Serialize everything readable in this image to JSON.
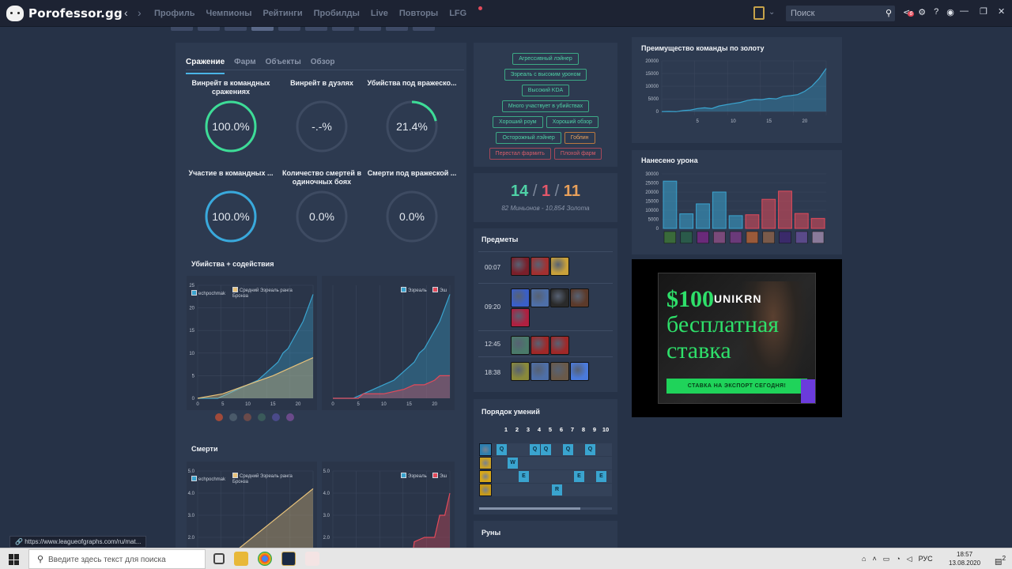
{
  "app": {
    "logo_text": "Porofessor.gg"
  },
  "nav": {
    "back": "‹",
    "forward": "›",
    "items": [
      "Профиль",
      "Чемпионы",
      "Рейтинги",
      "Пробилды",
      "Live",
      "Повторы",
      "LFG"
    ]
  },
  "search": {
    "placeholder": "Поиск"
  },
  "tabs": [
    "Сражение",
    "Фарм",
    "Объекты",
    "Обзор"
  ],
  "stats": [
    {
      "label": "Винрейт в командных сражениях",
      "value": "100.0%",
      "progress": 1.0,
      "color": "#3ddc97"
    },
    {
      "label": "Винрейт в дуэлях",
      "value": "-.-%",
      "progress": 0,
      "color": "#3ddc97"
    },
    {
      "label": "Убийства под вражеско...",
      "value": "21.4%",
      "progress": 0.214,
      "color": "#3ddc97"
    },
    {
      "label": "Участие в командных ...",
      "value": "100.0%",
      "progress": 1.0,
      "color": "#39a9dc"
    },
    {
      "label": "Количество смертей в одиночных боях",
      "value": "0.0%",
      "progress": 0,
      "color": "#39a9dc"
    },
    {
      "label": "Смерти под вражеской ...",
      "value": "0.0%",
      "progress": 0,
      "color": "#39a9dc"
    }
  ],
  "kills_section": {
    "title": "Убийства + содействия"
  },
  "deaths_section": {
    "title": "Смерти"
  },
  "chart_data": [
    {
      "type": "area",
      "title": "Убийства + содействия",
      "ylim": [
        0,
        25
      ],
      "yticks": [
        0,
        5,
        10,
        15,
        20,
        25
      ],
      "xticks": [
        0,
        5,
        10,
        15,
        20
      ],
      "series": [
        {
          "name": "echpochmak",
          "color": "#3aa4cf",
          "x": [
            0,
            4,
            6,
            8,
            10,
            12,
            14,
            15,
            16,
            17,
            18,
            19,
            20,
            21,
            22,
            23
          ],
          "values": [
            0,
            0,
            1,
            2,
            3,
            4,
            6,
            7,
            8,
            10,
            11,
            13,
            15,
            17,
            20,
            23
          ]
        },
        {
          "name": "Средний Эзреаль ранга Бронза",
          "color": "#e8c27a",
          "x": [
            0,
            5,
            10,
            15,
            20,
            23
          ],
          "values": [
            0,
            1,
            3,
            5,
            7.5,
            9
          ]
        }
      ]
    },
    {
      "type": "area",
      "title": "",
      "ylim": [
        0,
        25
      ],
      "xticks": [
        0,
        5,
        10,
        15,
        20
      ],
      "series": [
        {
          "name": "Эзреаль",
          "color": "#3aa4cf",
          "x": [
            0,
            4,
            6,
            8,
            10,
            12,
            14,
            15,
            16,
            17,
            18,
            19,
            20,
            21,
            22,
            23
          ],
          "values": [
            0,
            0,
            1,
            2,
            3,
            4,
            6,
            7,
            8,
            10,
            11,
            13,
            15,
            17,
            20,
            23
          ]
        },
        {
          "name": "Эш",
          "color": "#e24a5a",
          "x": [
            0,
            5,
            6,
            10,
            14,
            16,
            18,
            20,
            21,
            23
          ],
          "values": [
            0,
            0,
            1,
            1,
            2,
            3,
            3,
            4,
            5,
            5
          ]
        }
      ]
    },
    {
      "type": "area",
      "title": "Смерти",
      "ylim": [
        0,
        5
      ],
      "yticks": [
        2.0,
        3.0,
        4.0,
        5.0
      ],
      "series": [
        {
          "name": "echpochmak",
          "color": "#3aa4cf",
          "x": [
            0,
            23
          ],
          "values": [
            0,
            0
          ]
        },
        {
          "name": "Средний Эзреаль ранга Бронза",
          "color": "#e8c27a",
          "x": [
            0,
            23
          ],
          "values": [
            0,
            4.2
          ]
        }
      ]
    },
    {
      "type": "area",
      "title": "",
      "ylim": [
        0,
        5
      ],
      "yticks": [
        2.0,
        3.0,
        4.0,
        5.0
      ],
      "series": [
        {
          "name": "Эзреаль",
          "color": "#3aa4cf",
          "x": [
            0,
            23
          ],
          "values": [
            0,
            0
          ]
        },
        {
          "name": "Эш",
          "color": "#e24a5a",
          "x": [
            0,
            15,
            16,
            18,
            20,
            21,
            22,
            23
          ],
          "values": [
            0,
            0,
            1.8,
            2,
            2,
            3,
            3,
            4
          ]
        }
      ]
    },
    {
      "type": "area",
      "title": "Преимущество команды по золоту",
      "ylim": [
        0,
        20000
      ],
      "yticks": [
        0,
        5000,
        10000,
        15000,
        20000
      ],
      "xticks": [
        5,
        10,
        15,
        20
      ],
      "series": [
        {
          "name": "gold",
          "color": "#3aa4cf",
          "x": [
            0,
            1,
            2,
            3,
            4,
            5,
            6,
            7,
            8,
            9,
            10,
            11,
            12,
            13,
            14,
            15,
            16,
            17,
            18,
            19,
            20,
            21,
            22,
            23
          ],
          "values": [
            0,
            50,
            -30,
            400,
            600,
            1200,
            1500,
            1200,
            2200,
            2700,
            3200,
            3600,
            4400,
            4800,
            4700,
            5200,
            5000,
            6000,
            6300,
            6700,
            8000,
            10000,
            13000,
            17000
          ]
        }
      ]
    },
    {
      "type": "bar",
      "title": "Нанесено урона",
      "ylim": [
        0,
        30000
      ],
      "yticks": [
        0,
        5000,
        10000,
        15000,
        20000,
        25000,
        30000
      ],
      "series": [
        {
          "name": "damage",
          "values": [
            26000,
            8000,
            13500,
            20000,
            7000,
            7500,
            16000,
            20500,
            8200,
            5500
          ],
          "colors": [
            "#3aa4cf",
            "#3aa4cf",
            "#3aa4cf",
            "#3aa4cf",
            "#3aa4cf",
            "#e24a5a",
            "#e24a5a",
            "#e24a5a",
            "#e24a5a",
            "#e24a5a"
          ]
        }
      ]
    }
  ],
  "chart_labels": {
    "a": "echpochmak",
    "b": "Средний Эзреаль ранга Бронза",
    "c": "Эзреаль",
    "d": "Эш"
  },
  "tags": {
    "rows": [
      [
        {
          "text": "Агрессивный лэйнер",
          "kind": "g"
        }
      ],
      [
        {
          "text": "Эзреаль с высоким уроном",
          "kind": "g"
        }
      ],
      [
        {
          "text": "Высокий KDA",
          "kind": "g"
        }
      ],
      [
        {
          "text": "Много участвует в убийствах",
          "kind": "g"
        }
      ],
      [
        {
          "text": "Хороший роум",
          "kind": "g"
        },
        {
          "text": "Хороший обзор",
          "kind": "g"
        }
      ],
      [
        {
          "text": "Осторожный лэйнер",
          "kind": "g"
        },
        {
          "text": "Гоблин",
          "kind": "o"
        }
      ],
      [
        {
          "text": "Перестал фармить",
          "kind": "r"
        },
        {
          "text": "Плохой фарм",
          "kind": "r"
        }
      ]
    ]
  },
  "kda": {
    "kills": "14",
    "deaths": "1",
    "assists": "11",
    "sep": "/",
    "sub": "82 Миньонов - 10,854 Золота"
  },
  "items": {
    "title": "Предметы",
    "rows": [
      {
        "time": "00:07",
        "icons": [
          "#7a1f2a",
          "#a33030",
          "#c9a13a"
        ]
      },
      {
        "time": "09:20",
        "icons": [
          "#3a5fc8",
          "#4e6fa8",
          "#2a2a2a",
          "#5c3a2a",
          "#b02040"
        ]
      },
      {
        "time": "12:45",
        "icons": [
          "#4a7a6a",
          "#a02828",
          "#a02828"
        ]
      },
      {
        "time": "18:38",
        "icons": [
          "#8a8a3a",
          "#4e6fa8",
          "#6a5a4a",
          "#4a7adc"
        ]
      }
    ]
  },
  "skills": {
    "title": "Порядок умений",
    "levels": [
      "1",
      "2",
      "3",
      "4",
      "5",
      "6",
      "7",
      "8",
      "9",
      "10"
    ],
    "rows": [
      {
        "key": "Q",
        "icon": "#2d7fb0",
        "cells": [
          0,
          3,
          4,
          6,
          8
        ]
      },
      {
        "key": "W",
        "icon": "#c8a028",
        "cells": [
          1
        ]
      },
      {
        "key": "E",
        "icon": "#d8a818",
        "cells": [
          2,
          7,
          9
        ]
      },
      {
        "key": "R",
        "icon": "#c89a18",
        "cells": [
          5
        ]
      }
    ]
  },
  "runes": {
    "title": "Руны"
  },
  "gold_panel": {
    "title": "Преимущество команды по золоту"
  },
  "damage_panel": {
    "title": "Нанесено урона"
  },
  "damage_champs": [
    "#3a6a3a",
    "#2a5a4a",
    "#6a2a7a",
    "#7a4a7a",
    "#6a3a7a",
    "#9a5a3a",
    "#7a5a4a",
    "#3a2a6a",
    "#5a4a8a",
    "#8a7a9a"
  ],
  "ad": {
    "amount": "$100",
    "brand": "UNIKRN",
    "big_line1": "бесплатная",
    "big_line2": "ставка",
    "button": "СТАВКА НА ЭКСПОРТ СЕГОДНЯ!"
  },
  "status_url": "https://www.leagueofgraphs.com/ru/mat...",
  "taskbar": {
    "search": "Введите здесь текст для поиска",
    "lang": "РУС",
    "time": "18:57",
    "date": "13.08.2020",
    "notif_count": "2"
  }
}
